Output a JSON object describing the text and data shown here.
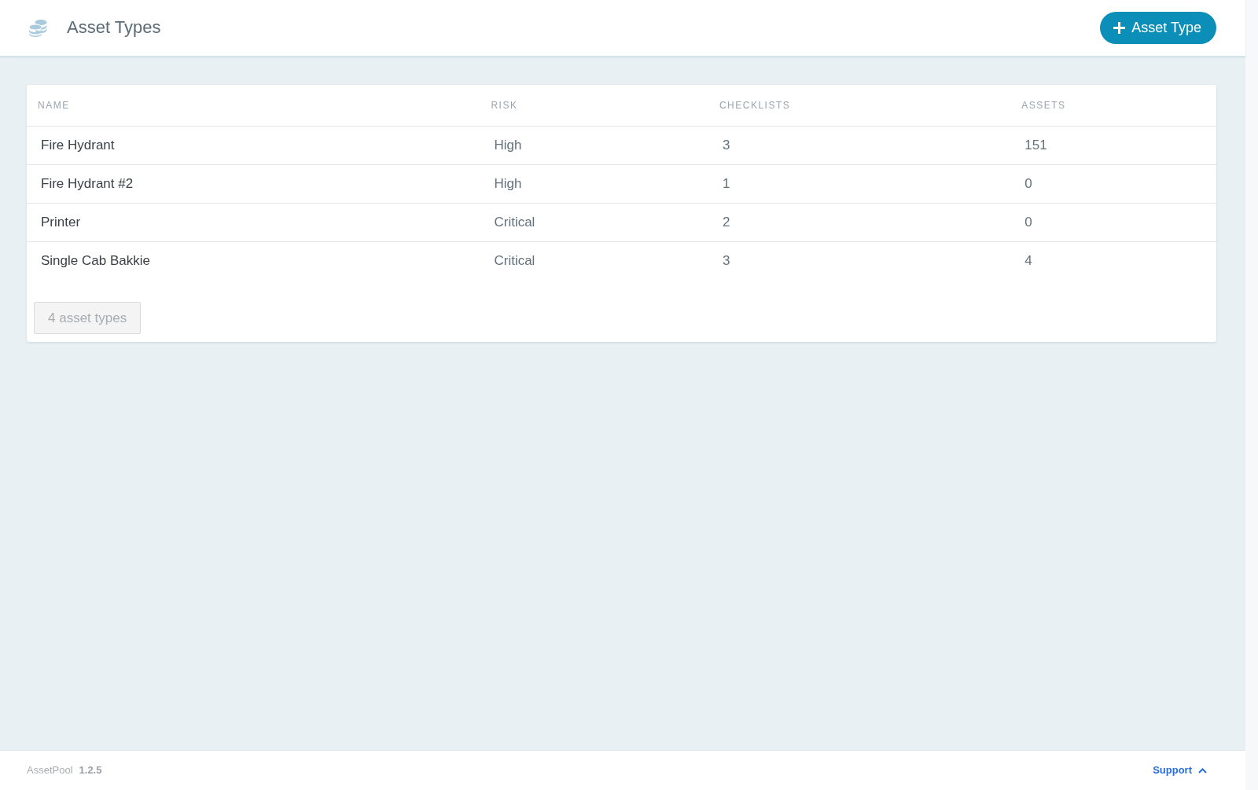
{
  "header": {
    "title": "Asset Types",
    "add_button": {
      "label": "Asset Type"
    }
  },
  "table": {
    "columns": [
      "NAME",
      "RISK",
      "CHECKLISTS",
      "ASSETS"
    ],
    "rows": [
      [
        "Fire Hydrant",
        "High",
        "3",
        "151"
      ],
      [
        "Fire Hydrant #2",
        "High",
        "1",
        "0"
      ],
      [
        "Printer",
        "Critical",
        "2",
        "0"
      ],
      [
        "Single Cab Bakkie",
        "Critical",
        "3",
        "4"
      ]
    ],
    "count": "4 asset types"
  },
  "footer": {
    "app_name": "AssetPool",
    "version": "1.2.5",
    "support_link": "Support"
  }
}
